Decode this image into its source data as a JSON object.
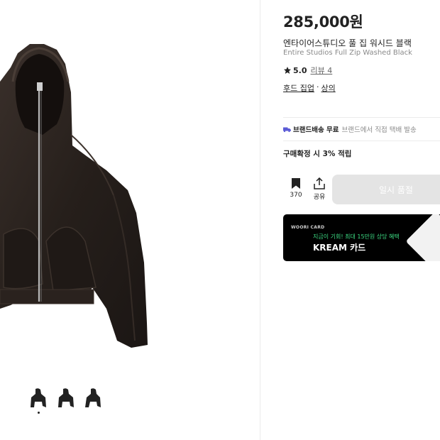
{
  "product": {
    "price": "285,000원",
    "title_ko": "엔타이어스튜디오 풀 집 워시드 블랙",
    "title_en": "Entire Studios Full Zip Washed Black",
    "rating": "5.0",
    "review_link": "리뷰 4",
    "category": {
      "primary": "후드 집업",
      "separator": "·",
      "secondary": "상의"
    }
  },
  "shipping": {
    "icon": "truck-icon",
    "label": "브랜드배송 무료",
    "description": "브랜드에서 직접 택배 발송"
  },
  "points_text": "구매확정 시 3% 적립",
  "actions": {
    "bookmark": {
      "icon": "bookmark-icon",
      "count": "370"
    },
    "share": {
      "icon": "share-icon",
      "label": "공유"
    },
    "buy_label": "일시 품절"
  },
  "banner": {
    "brand": "WOORI CARD",
    "promo": "지금이 기회! 최대 15만원 상당 혜택",
    "title": "KREAM 카드"
  },
  "gallery": {
    "thumbnail_count": 3,
    "active_index": 0
  },
  "colors": {
    "accent": "#5b5bd6",
    "promo_green": "#3ddc84",
    "buy_disabled": "#e4e4e4",
    "hoodie": "#2b2420"
  }
}
